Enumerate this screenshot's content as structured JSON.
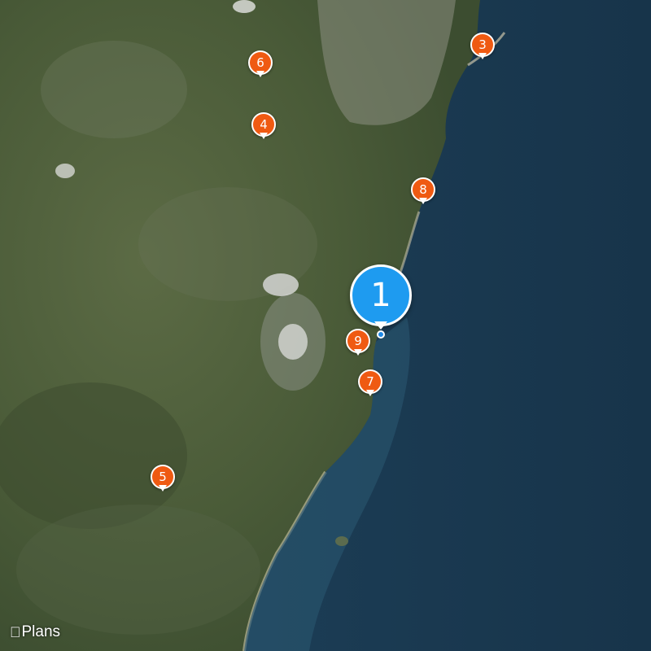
{
  "map": {
    "type": "satellite",
    "attribution": {
      "logo_icon": "apple-logo-icon",
      "label": "Plans"
    },
    "colors": {
      "sea": "#1c3a52",
      "land": "#4b5f3a",
      "pin_orange": "#ef5a12",
      "pin_blue": "#1e9bf0"
    },
    "selected_pin": {
      "label": "1"
    },
    "pins": [
      {
        "id": "pin-3",
        "label": "3"
      },
      {
        "id": "pin-4",
        "label": "4"
      },
      {
        "id": "pin-5",
        "label": "5"
      },
      {
        "id": "pin-6",
        "label": "6"
      },
      {
        "id": "pin-7",
        "label": "7"
      },
      {
        "id": "pin-8",
        "label": "8"
      },
      {
        "id": "pin-9",
        "label": "9"
      }
    ]
  }
}
